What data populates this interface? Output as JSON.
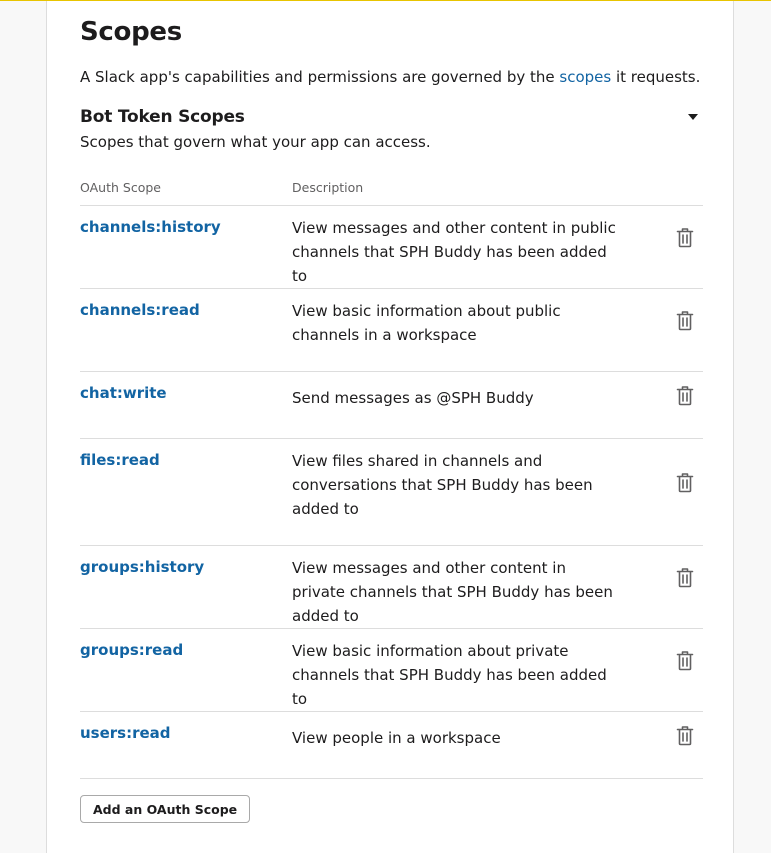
{
  "page": {
    "title": "Scopes",
    "intro": {
      "before": "A Slack app's capabilities and permissions are governed by the ",
      "link": "scopes",
      "after": " it requests."
    }
  },
  "bot_token_scopes": {
    "title": "Bot Token Scopes",
    "subtitle": "Scopes that govern what your app can access.",
    "columns": {
      "scope": "OAuth Scope",
      "description": "Description"
    },
    "rows": [
      {
        "scope": "channels:history",
        "description": "View messages and other content in public channels that SPH Buddy has been added to"
      },
      {
        "scope": "channels:read",
        "description": "View basic information about public channels in a workspace"
      },
      {
        "scope": "chat:write",
        "description": "Send messages as @SPH Buddy"
      },
      {
        "scope": "files:read",
        "description": "View files shared in channels and conversations that SPH Buddy has been added to"
      },
      {
        "scope": "groups:history",
        "description": "View messages and other content in private channels that SPH Buddy has been added to"
      },
      {
        "scope": "groups:read",
        "description": "View basic information about private channels that SPH Buddy has been added to"
      },
      {
        "scope": "users:read",
        "description": "View people in a workspace"
      }
    ],
    "add_button": "Add an OAuth Scope"
  },
  "icons": {
    "collapse": "caret-down-icon",
    "delete": "trash-icon"
  },
  "colors": {
    "link": "#1264a3",
    "text": "#1d1c1d",
    "muted": "#616061",
    "accent_rule": "#e8c400"
  }
}
